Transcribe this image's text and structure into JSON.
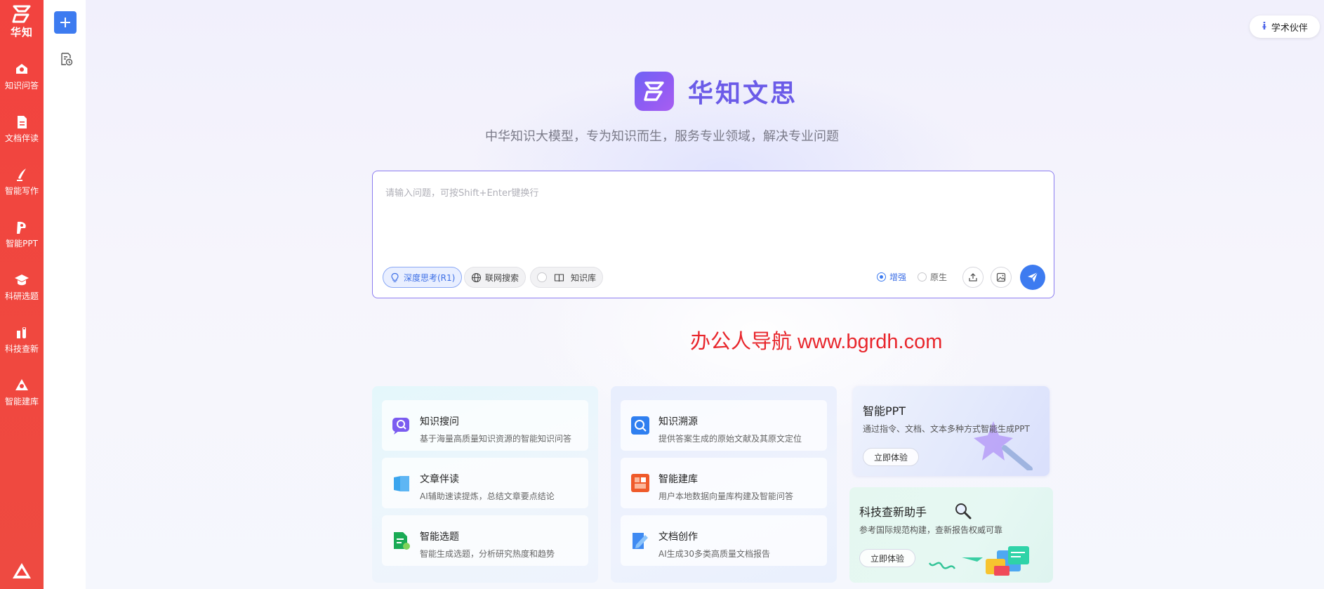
{
  "rail": {
    "logo_text": "华知",
    "items": [
      {
        "label": "知识问答",
        "icon": "qa-icon"
      },
      {
        "label": "文档伴读",
        "icon": "document-icon"
      },
      {
        "label": "智能写作",
        "icon": "pen-icon"
      },
      {
        "label": "智能PPT",
        "icon": "ppt-icon"
      },
      {
        "label": "科研选题",
        "icon": "graduation-cap-icon"
      },
      {
        "label": "科技查新",
        "icon": "search-doc-icon"
      },
      {
        "label": "智能建库",
        "icon": "database-icon"
      }
    ]
  },
  "header": {
    "partner_label": "学术伙伴",
    "partner_icon": "partner-icon"
  },
  "brand": {
    "name": "华知文思",
    "subtitle": "中华知识大模型，专为知识而生，服务专业领域，解决专业问题"
  },
  "query": {
    "placeholder": "请输入问题，可按Shift+Enter键换行",
    "value": "",
    "chips": [
      "深度思考(R1)",
      "联网搜索",
      "知识库"
    ],
    "modes": [
      "增强",
      "原生"
    ],
    "selected_mode": "增强"
  },
  "watermark": "办公人导航 www.bgrdh.com",
  "features_left": [
    {
      "title": "知识搜问",
      "desc": "基于海量高质量知识资源的智能知识问答"
    },
    {
      "title": "文章伴读",
      "desc": "AI辅助速读提炼，总结文章要点结论"
    },
    {
      "title": "智能选题",
      "desc": "智能生成选题，分析研究热度和趋势"
    }
  ],
  "features_mid": [
    {
      "title": "知识溯源",
      "desc": "提供答案生成的原始文献及其原文定位"
    },
    {
      "title": "智能建库",
      "desc": "用户本地数据向量库构建及智能问答"
    },
    {
      "title": "文档创作",
      "desc": "AI生成30多类高质量文档报告"
    }
  ],
  "promos": {
    "ppt": {
      "title": "智能PPT",
      "desc": "通过指令、文档、文本多种方式智能生成PPT",
      "button": "立即体验"
    },
    "sci": {
      "title": "科技查新助手",
      "desc": "参考国际规范构建，查新报告权威可靠",
      "button": "立即体验"
    }
  },
  "colors": {
    "rail": "#f2433f",
    "accent": "#3d7bf0",
    "brand": "#6b5be8",
    "watermark": "#e8252b"
  }
}
